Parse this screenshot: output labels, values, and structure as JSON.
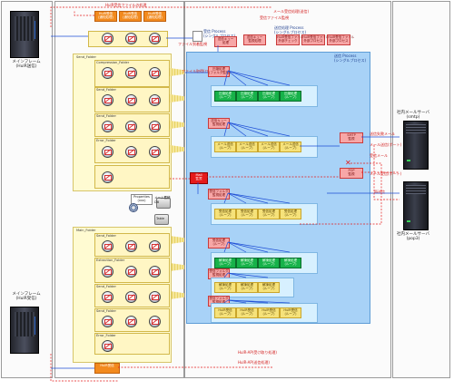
{
  "left_servers": {
    "top_label": "メインフレーム\n(HulR送信)",
    "bottom_label": "メインフレーム\n(HulR受信)"
  },
  "right_servers": {
    "top_label": "社内メールサーバ\n(smtp)",
    "bottom_label": "社内メールサーバ\n(pop3)"
  },
  "top_orange_boxes": [
    "HulR受信\n(通知処理)",
    "HulR受信\n(通知処理)",
    "HulR受信\n(通知処理)",
    "HulR受信\n(通知処理)"
  ],
  "top_annotations": {
    "hulr_receive": "HulR受信ファイルの処理",
    "mail_receive": "メール受信処理(送信)",
    "rcv_scan": "受信ファイル監視",
    "process_single": "受信 Process\n(シングルプロセス)",
    "process_single_2": "送信処理 Process\n(シングルプロセス)",
    "file_watch": "ファイル到着監視",
    "file_watch_2": "ファイル到着監視プロセス"
  },
  "top_pink_boxes": [
    "送信キュー\n監視処理",
    "HulR受信ファイル\n外部チェック",
    "HulR受信ファイル\n外部プロセス",
    "HulR受信ファイル\n外部プロセス"
  ],
  "top_pink_boxes_2": [
    "送信キュー\n処理",
    "HulR送信ファイル\n外部プロセス"
  ],
  "send_section": {
    "panel_title": "送信 Process\n(シングルプロセス)",
    "folders": [
      "Send_Folder",
      "Compression_Folder",
      "Send_Folder",
      "Send_Folder",
      "Error_Folder"
    ],
    "fetch_label": "ファイル取得(ローラ)"
  },
  "recv_section": {
    "folders": [
      "Main_Folder",
      "Send_Folder",
      "Extraction_Folder",
      "Send_Folder",
      "Send_Folder",
      "Error_Folder"
    ]
  },
  "center_pink": [
    "圧縮処理\n(フォルダ監視)",
    "送信キュー\n監視処理",
    "メール送信\n(パラメタ)",
    "受信フォルダ\n監視処理",
    "受信処理\n(ループ)",
    "受信フォルダ\n監視処理",
    "受信フォルダ\n監視処理"
  ],
  "green_rows": [
    [
      "圧縮処理\n(ループ)",
      "圧縮処理\n(ループ)",
      "圧縮処理\n(ループ)",
      "圧縮処理\n(ループ)"
    ],
    [
      "解凍処理\n(ループ)",
      "解凍処理\n(ループ)",
      "解凍処理\n(ループ)",
      "解凍処理\n(ループ)"
    ]
  ],
  "light_rows": [
    [
      "メール送信\n(ループ)",
      "メール送信\n(ループ)",
      "メール送信\n(ループ)",
      "メール送信\n(ループ)"
    ],
    [
      "受信処理\n(ループ)",
      "受信処理\n(ループ)",
      "受信処理\n(ループ)",
      "受信処理\n(ループ)"
    ],
    [
      "解凍処理\n(ループ)",
      "解凍処理\n(ループ)",
      "解凍処理\n(ループ)"
    ],
    [
      "HulR受信\n(ループ)",
      "HulR受信\n(ループ)",
      "HulR受信\n(ループ)",
      "HulR受信\n(ループ)"
    ]
  ],
  "center_labels": {
    "main_red": "Mail\n監視",
    "send_queue": "SMTP\n監視",
    "recv_queue": "POP\n監視",
    "properties": "Properties\n(xxx)",
    "db_label": "メール蓄積\nDB",
    "table_label": "Table",
    "error_mail": "送信失敗メール",
    "recv_mail": "受信メール",
    "smtp_out": "メール送信(ポート)",
    "pop_in": "メール受信(ポート)",
    "retry": "再送信",
    "hulr_send_label": "HulR受信",
    "bottom_note": "HulR-AP(受け取り処理)",
    "bottom_note_2": "HulR-AP(送信処理)"
  },
  "colors": {
    "orange": "#f28a1e",
    "pink": "#f7a7a7",
    "green": "#17b24a",
    "blue_panel": "#a8d2f7",
    "yellow_panel": "#fffbd2",
    "red": "#e51b1b"
  }
}
